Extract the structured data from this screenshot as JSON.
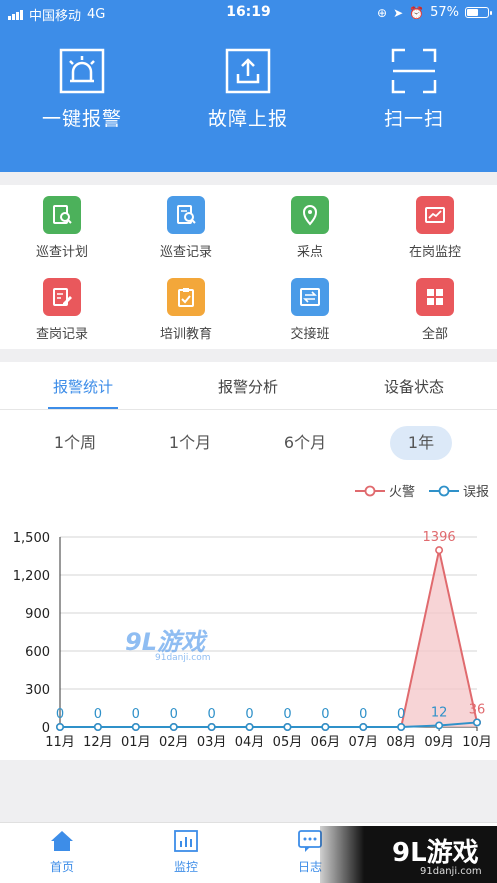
{
  "status_bar": {
    "carrier": "中国移动",
    "network": "4G",
    "time": "16:19",
    "battery": "57%",
    "battery_level": 0.57
  },
  "header": {
    "buttons": [
      {
        "label": "一键报警",
        "icon": "alarm-light-icon"
      },
      {
        "label": "故障上报",
        "icon": "upload-icon"
      },
      {
        "label": "扫一扫",
        "icon": "scan-icon"
      }
    ]
  },
  "grid": {
    "items": [
      {
        "label": "巡查计划",
        "icon": "plan-search-icon",
        "color": "#4cb15b"
      },
      {
        "label": "巡查记录",
        "icon": "record-search-icon",
        "color": "#4a9be8"
      },
      {
        "label": "采点",
        "icon": "location-pin-icon",
        "color": "#4cb15b"
      },
      {
        "label": "在岗监控",
        "icon": "monitor-chart-icon",
        "color": "#e9585c"
      },
      {
        "label": "查岗记录",
        "icon": "edit-doc-icon",
        "color": "#e9585c"
      },
      {
        "label": "培训教育",
        "icon": "clipboard-check-icon",
        "color": "#f3a73a"
      },
      {
        "label": "交接班",
        "icon": "swap-icon",
        "color": "#4a9be8"
      },
      {
        "label": "全部",
        "icon": "grid-all-icon",
        "color": "#e9585c"
      }
    ]
  },
  "tabs": [
    "报警统计",
    "报警分析",
    "设备状态"
  ],
  "periods": [
    "1个周",
    "1个月",
    "6个月",
    "1年"
  ],
  "chart_data": {
    "type": "line",
    "categories": [
      "11月",
      "12月",
      "01月",
      "02月",
      "03月",
      "04月",
      "05月",
      "06月",
      "07月",
      "08月",
      "09月",
      "10月"
    ],
    "series": [
      {
        "name": "火警",
        "color": "#e06a6e",
        "values": [
          0,
          0,
          0,
          0,
          0,
          0,
          0,
          0,
          0,
          0,
          1396,
          36
        ],
        "area": true
      },
      {
        "name": "误报",
        "color": "#2f91c9",
        "values": [
          0,
          0,
          0,
          0,
          0,
          0,
          0,
          0,
          0,
          0,
          12,
          36
        ]
      }
    ],
    "yticks": [
      "0",
      "300",
      "600",
      "900",
      "1,200",
      "1,500"
    ],
    "ylim": [
      0,
      1500
    ],
    "grid": true,
    "legend": "top-right",
    "point_labels": [
      {
        "text": "0",
        "i": 0,
        "series": 1
      },
      {
        "text": "0",
        "i": 1,
        "series": 1
      },
      {
        "text": "0",
        "i": 2,
        "series": 1
      },
      {
        "text": "0",
        "i": 3,
        "series": 1
      },
      {
        "text": "0",
        "i": 4,
        "series": 1
      },
      {
        "text": "0",
        "i": 5,
        "series": 1
      },
      {
        "text": "0",
        "i": 6,
        "series": 1
      },
      {
        "text": "0",
        "i": 7,
        "series": 1
      },
      {
        "text": "0",
        "i": 8,
        "series": 1
      },
      {
        "text": "0",
        "i": 9,
        "series": 1
      },
      {
        "text": "1396",
        "i": 10,
        "series": 0
      },
      {
        "text": "12",
        "i": 10,
        "series": 1
      },
      {
        "text": "36",
        "i": 11,
        "series": 0
      }
    ]
  },
  "watermark": {
    "logo": "9L游戏",
    "site": "91danji.com"
  },
  "tabbar": [
    {
      "label": "首页",
      "icon": "home-icon"
    },
    {
      "label": "监控",
      "icon": "monitor-icon"
    },
    {
      "label": "日志",
      "icon": "log-icon"
    }
  ]
}
